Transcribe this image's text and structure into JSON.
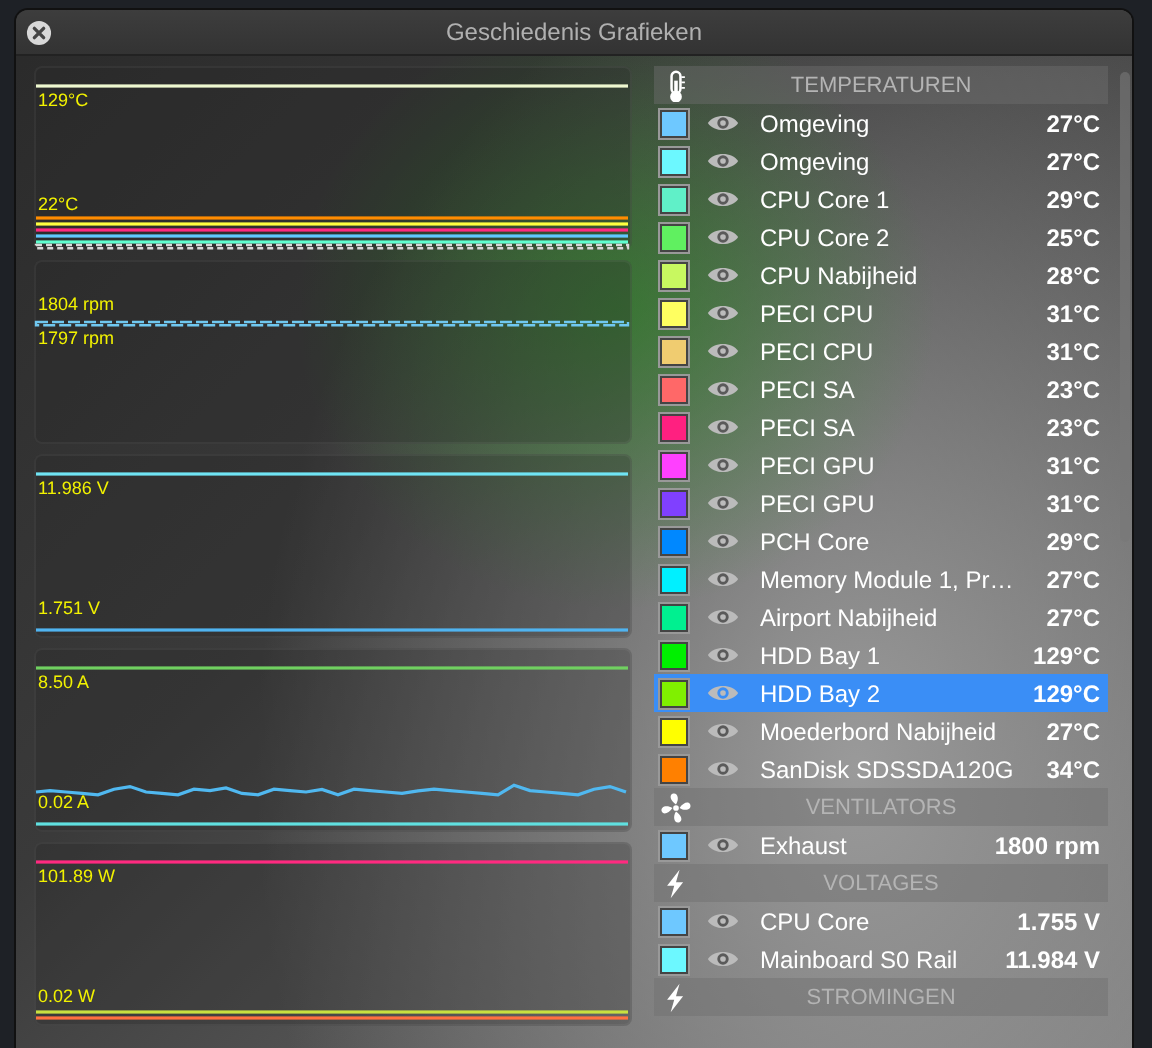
{
  "window": {
    "title": "Geschiedenis Grafieken"
  },
  "graphs": [
    {
      "kind": "spread",
      "max_label": "129°C",
      "min_label": "22°C",
      "lines": [
        {
          "kind": "max",
          "color": "#eef8d0"
        },
        {
          "kind": "min",
          "color": "#ff8c00"
        },
        {
          "kind": "min",
          "color": "#ffff40"
        },
        {
          "kind": "min",
          "color": "#ff2a80"
        },
        {
          "kind": "min",
          "color": "#60c8ff"
        },
        {
          "kind": "min",
          "color": "#60ffd0"
        },
        {
          "kind": "dashed",
          "color": "#d8d8d8"
        }
      ]
    },
    {
      "kind": "flat",
      "max_label": "1804 rpm",
      "min_label": "1797 rpm",
      "lines": [
        {
          "kind": "mid",
          "color": "#70c8f0"
        }
      ]
    },
    {
      "kind": "spread",
      "max_label": "11.986 V",
      "min_label": "1.751 V",
      "lines": [
        {
          "kind": "max",
          "color": "#70e4f4"
        },
        {
          "kind": "min",
          "color": "#50b4f0"
        }
      ]
    },
    {
      "kind": "spread",
      "max_label": "8.50 A",
      "min_label": "0.02 A",
      "lines": [
        {
          "kind": "max",
          "color": "#70d060"
        },
        {
          "kind": "wavy",
          "color": "#50b8f0"
        },
        {
          "kind": "min",
          "color": "#60e0e0"
        }
      ]
    },
    {
      "kind": "spread",
      "max_label": "101.89 W",
      "min_label": "0.02 W",
      "lines": [
        {
          "kind": "max",
          "color": "#ff2a80"
        },
        {
          "kind": "min",
          "color": "#c8e040"
        },
        {
          "kind": "min",
          "color": "#ff7040"
        }
      ]
    }
  ],
  "sections": [
    {
      "title": "TEMPERATUREN",
      "kind": "temperature",
      "sensors": [
        {
          "name": "Omgeving",
          "value": "27°C",
          "color": "#6ec8ff",
          "selected": false
        },
        {
          "name": "Omgeving",
          "value": "27°C",
          "color": "#6cf8ff",
          "selected": false
        },
        {
          "name": "CPU Core 1",
          "value": "29°C",
          "color": "#60f0c8",
          "selected": false
        },
        {
          "name": "CPU Core 2",
          "value": "25°C",
          "color": "#60f060",
          "selected": false
        },
        {
          "name": "CPU Nabijheid",
          "value": "28°C",
          "color": "#c8f860",
          "selected": false
        },
        {
          "name": "PECI CPU",
          "value": "31°C",
          "color": "#ffff60",
          "selected": false
        },
        {
          "name": "PECI CPU",
          "value": "31°C",
          "color": "#f0cc70",
          "selected": false
        },
        {
          "name": "PECI SA",
          "value": "23°C",
          "color": "#ff6868",
          "selected": false
        },
        {
          "name": "PECI SA",
          "value": "23°C",
          "color": "#ff2080",
          "selected": false
        },
        {
          "name": "PECI GPU",
          "value": "31°C",
          "color": "#ff40ff",
          "selected": false
        },
        {
          "name": "PECI GPU",
          "value": "31°C",
          "color": "#8040ff",
          "selected": false
        },
        {
          "name": "PCH Core",
          "value": "29°C",
          "color": "#0088ff",
          "selected": false
        },
        {
          "name": "Memory Module 1, Pr…",
          "value": "27°C",
          "color": "#00f0ff",
          "selected": false
        },
        {
          "name": "Airport Nabijheid",
          "value": "27°C",
          "color": "#00f090",
          "selected": false
        },
        {
          "name": "HDD Bay 1",
          "value": "129°C",
          "color": "#00f000",
          "selected": false
        },
        {
          "name": "HDD Bay 2",
          "value": "129°C",
          "color": "#80f000",
          "selected": true
        },
        {
          "name": "Moederbord Nabijheid",
          "value": "27°C",
          "color": "#ffff00",
          "selected": false
        },
        {
          "name": "SanDisk SDSSDA120G",
          "value": "34°C",
          "color": "#ff8000",
          "selected": false
        }
      ]
    },
    {
      "title": "VENTILATORS",
      "kind": "fan",
      "sensors": [
        {
          "name": "Exhaust",
          "value": "1800 rpm",
          "color": "#6ec8ff",
          "selected": false
        }
      ]
    },
    {
      "title": "VOLTAGES",
      "kind": "voltage",
      "sensors": [
        {
          "name": "CPU Core",
          "value": "1.755 V",
          "color": "#6ec8ff",
          "selected": false
        },
        {
          "name": "Mainboard S0 Rail",
          "value": "11.984 V",
          "color": "#6cf8ff",
          "selected": false
        }
      ]
    },
    {
      "title": "STROMINGEN",
      "kind": "current"
    }
  ]
}
